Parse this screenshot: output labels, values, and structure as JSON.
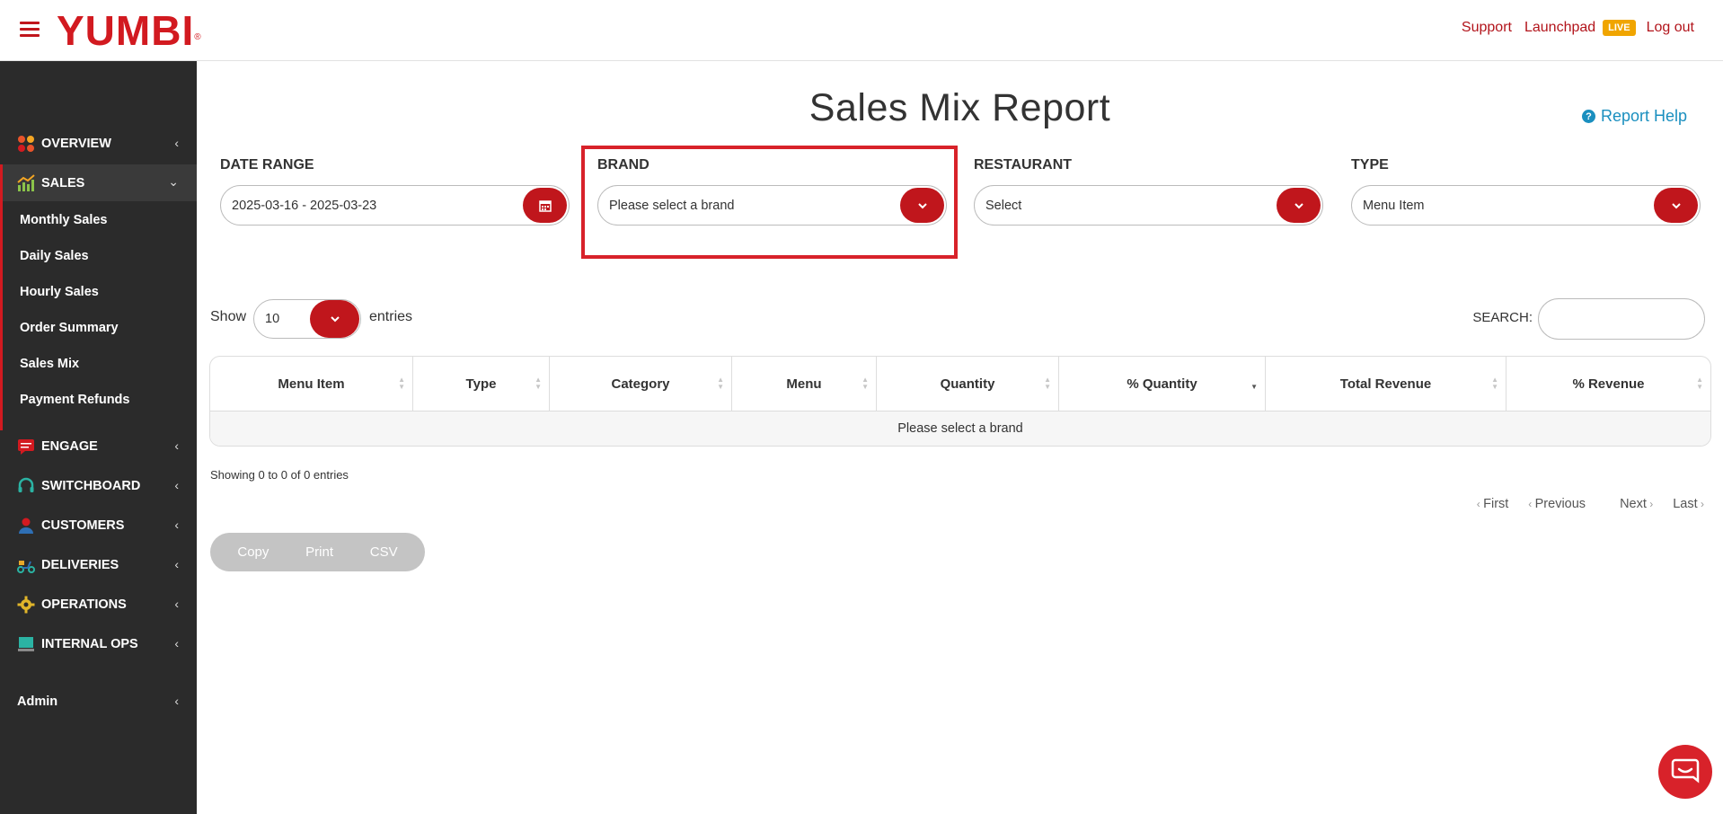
{
  "header": {
    "logo": "YUMBI",
    "logo_mark": "®",
    "links": {
      "support": "Support",
      "launchpad": "Launchpad",
      "live_badge": "LIVE",
      "logout": "Log out"
    }
  },
  "sidebar": {
    "sections": [
      {
        "label": "OVERVIEW",
        "icon": "overview-icon"
      },
      {
        "label": "SALES",
        "icon": "chart-icon"
      },
      {
        "label": "ENGAGE",
        "icon": "chat-icon"
      },
      {
        "label": "SWITCHBOARD",
        "icon": "headset-icon"
      },
      {
        "label": "CUSTOMERS",
        "icon": "person-icon"
      },
      {
        "label": "DELIVERIES",
        "icon": "scooter-icon"
      },
      {
        "label": "OPERATIONS",
        "icon": "gear-icon"
      },
      {
        "label": "INTERNAL OPS",
        "icon": "monitor-icon"
      },
      {
        "label": "Admin",
        "icon": ""
      }
    ],
    "sales_items": [
      "Monthly Sales",
      "Daily Sales",
      "Hourly Sales",
      "Order Summary",
      "Sales Mix",
      "Payment Refunds"
    ]
  },
  "main": {
    "title": "Sales Mix Report",
    "help_link": "Report Help",
    "filters": {
      "date_range": {
        "label": "DATE RANGE",
        "value": "2025-03-16 - 2025-03-23"
      },
      "brand": {
        "label": "BRAND",
        "value": "Please select a brand"
      },
      "restaurant": {
        "label": "RESTAURANT",
        "value": "Select"
      },
      "type": {
        "label": "TYPE",
        "value": "Menu Item"
      }
    },
    "length": {
      "show": "Show",
      "value": "10",
      "entries": "entries"
    },
    "search_label": "SEARCH:",
    "table": {
      "columns": [
        "Menu Item",
        "Type",
        "Category",
        "Menu",
        "Quantity",
        "% Quantity",
        "Total Revenue",
        "% Revenue"
      ],
      "empty_message": "Please select a brand"
    },
    "info": "Showing 0 to 0 of 0 entries",
    "pager": {
      "first": "First",
      "previous": "Previous",
      "next": "Next",
      "last": "Last"
    },
    "export": {
      "copy": "Copy",
      "print": "Print",
      "csv": "CSV"
    }
  },
  "colors": {
    "brand_red": "#c0161c",
    "sidebar_bg": "#2b2b2b",
    "live_badge": "#f0a500",
    "link_blue": "#1a8fbf"
  }
}
